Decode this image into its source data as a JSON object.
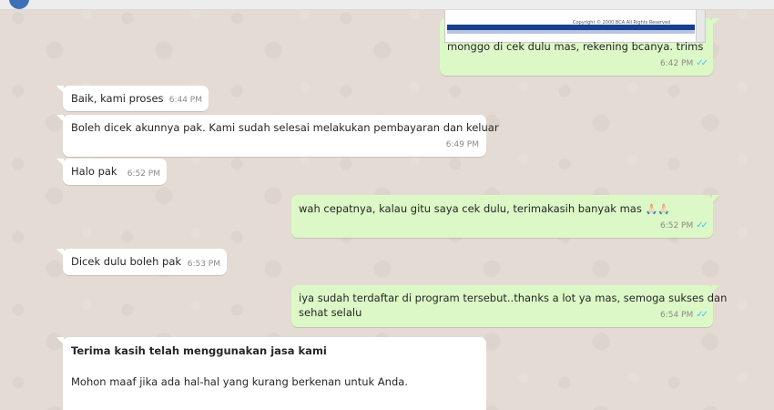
{
  "messages": [
    {
      "id": "m1",
      "direction": "outgoing",
      "image_caption": "Copyright © 2000 BCA All Rights Reserved",
      "text": "monggo di cek dulu mas, rekening bcanya. trims",
      "time": "6:42 PM",
      "status": "read"
    },
    {
      "id": "m2",
      "direction": "incoming",
      "text": "Baik, kami proses",
      "time": "6:44 PM"
    },
    {
      "id": "m3",
      "direction": "incoming",
      "text": "Boleh dicek akunnya pak. Kami sudah selesai melakukan pembayaran dan keluar",
      "time": "6:49 PM"
    },
    {
      "id": "m4",
      "direction": "incoming",
      "text": "Halo pak",
      "time": "6:52 PM"
    },
    {
      "id": "m5",
      "direction": "outgoing",
      "text": "wah cepatnya, kalau gitu saya cek dulu, terimakasih banyak mas",
      "emoji": "🙏🏻🙏🏻",
      "time": "6:52 PM",
      "status": "read"
    },
    {
      "id": "m6",
      "direction": "incoming",
      "text": "Dicek dulu boleh pak",
      "time": "6:53 PM"
    },
    {
      "id": "m7",
      "direction": "outgoing",
      "text_line1": "iya sudah terdaftar di program tersebut..thanks a lot ya mas, semoga sukses dan",
      "text_line2": "sehat selalu",
      "time": "6:54 PM",
      "status": "read"
    },
    {
      "id": "m8",
      "direction": "incoming",
      "title": "Terima kasih telah menggunakan jasa kami",
      "line1": "Mohon maaf jika ada hal-hal yang kurang berkenan untuk Anda."
    }
  ],
  "colors": {
    "wallpaper": "#e5ddd5",
    "incoming_bubble": "#ffffff",
    "outgoing_bubble": "#dcf8c6",
    "read_ticks": "#4fc3f7"
  },
  "icons": {
    "read_status": "double-check-icon"
  }
}
